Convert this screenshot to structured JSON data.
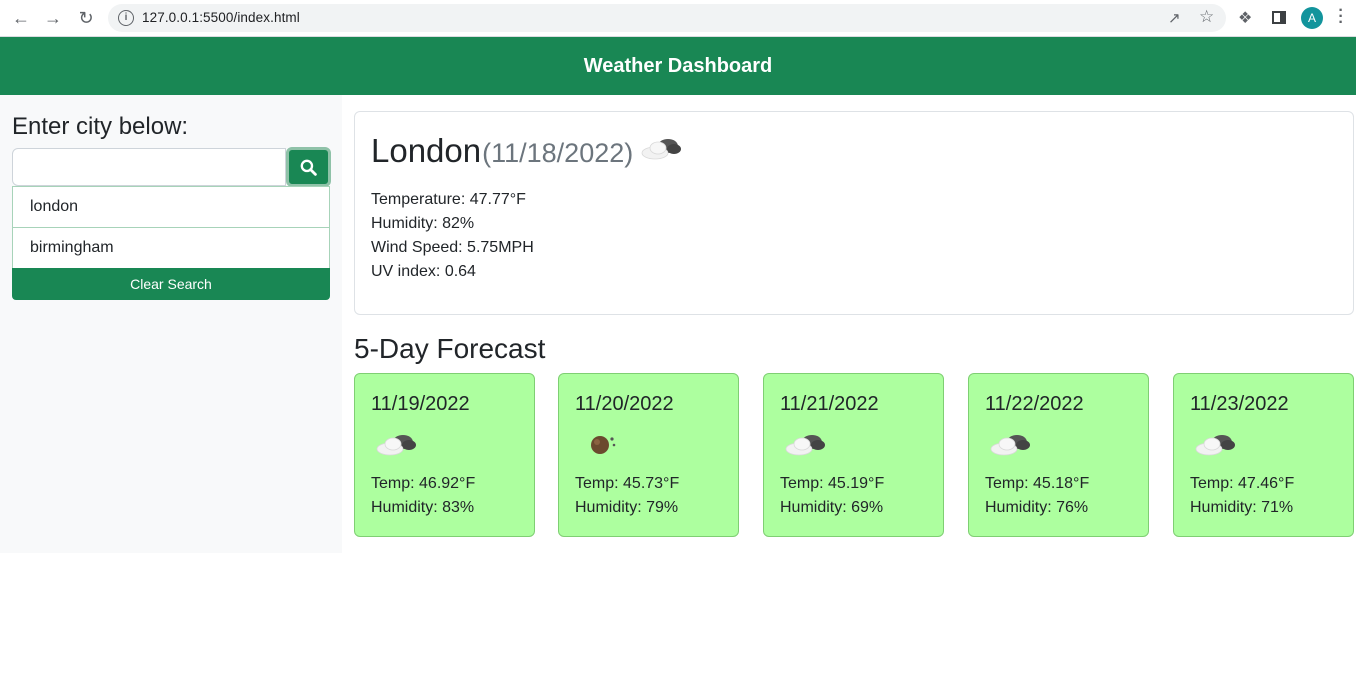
{
  "browser": {
    "url": "127.0.0.1:5500/index.html",
    "avatar_letter": "A"
  },
  "header": {
    "title": "Weather Dashboard"
  },
  "sidebar": {
    "label": "Enter city below:",
    "search_value": "",
    "history": [
      "london",
      "birmingham"
    ],
    "clear_label": "Clear Search"
  },
  "current": {
    "city": "London",
    "date": "(11/18/2022)",
    "icon": "broken-clouds-icon",
    "temperature": "Temperature: 47.77°F",
    "humidity": "Humidity: 82%",
    "wind": "Wind Speed: 5.75MPH",
    "uv": "UV index: 0.64"
  },
  "forecast": {
    "title": "5-Day Forecast",
    "days": [
      {
        "date": "11/19/2022",
        "icon": "broken-clouds-icon",
        "temp": "Temp: 46.92°F",
        "humidity": "Humidity: 83%"
      },
      {
        "date": "11/20/2022",
        "icon": "shower-rain-icon",
        "temp": "Temp: 45.73°F",
        "humidity": "Humidity: 79%"
      },
      {
        "date": "11/21/2022",
        "icon": "broken-clouds-icon",
        "temp": "Temp: 45.19°F",
        "humidity": "Humidity: 69%"
      },
      {
        "date": "11/22/2022",
        "icon": "broken-clouds-icon",
        "temp": "Temp: 45.18°F",
        "humidity": "Humidity: 76%"
      },
      {
        "date": "11/23/2022",
        "icon": "broken-clouds-icon",
        "temp": "Temp: 47.46°F",
        "humidity": "Humidity: 71%"
      }
    ]
  },
  "colors": {
    "primary": "#198754",
    "forecast_card": "#adff9f",
    "sidebar_bg": "#f8f9fa"
  }
}
